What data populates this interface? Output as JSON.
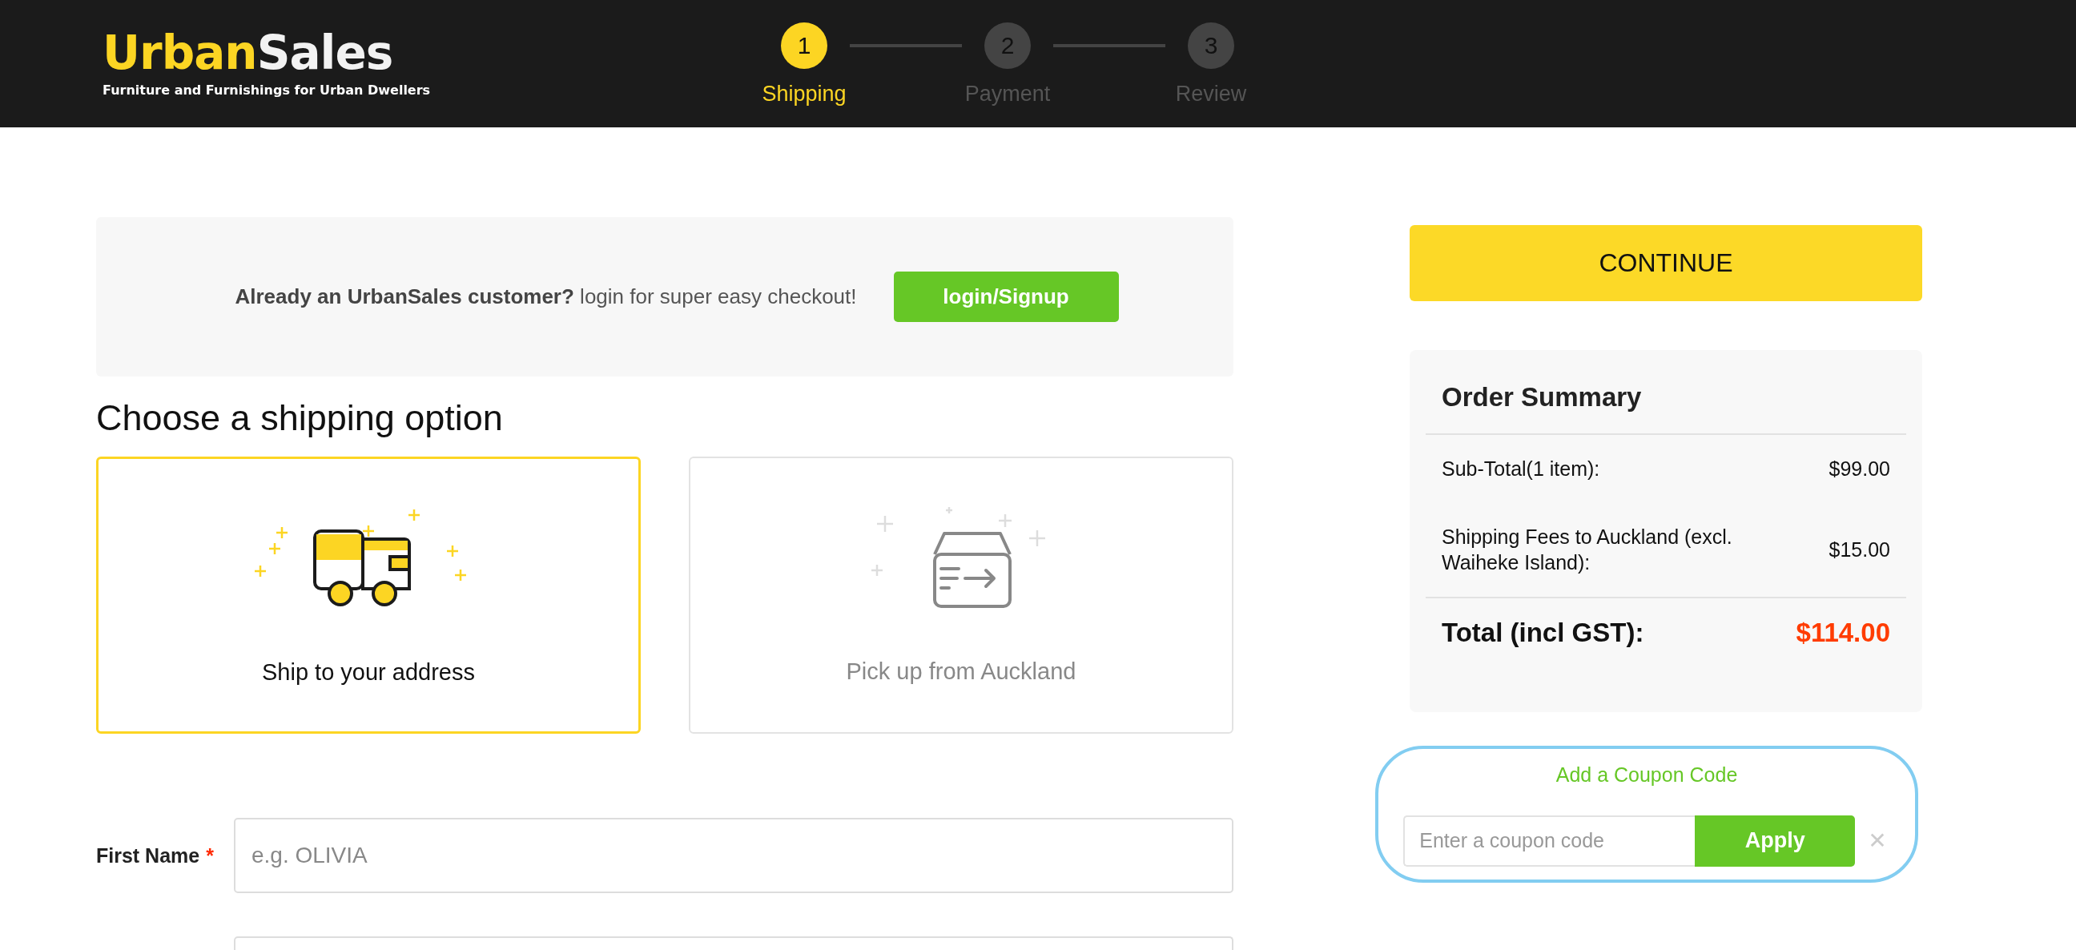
{
  "header": {
    "logo": {
      "part_1": "Urban",
      "part_2": "Sales"
    },
    "tagline": "Furniture and Furnishings for Urban Dwellers"
  },
  "steps": [
    {
      "number": "1",
      "label": "Shipping",
      "selected": true
    },
    {
      "number": "2",
      "label": "Payment",
      "selected": false
    },
    {
      "number": "3",
      "label": "Review",
      "selected": false
    }
  ],
  "login_banner": {
    "text": "**Already an UrbanSales customer?** login for super easy checkout!",
    "button": "login/Signup"
  },
  "shipping": {
    "heading": "Choose a shipping option",
    "options": [
      {
        "kind": "truck",
        "label": "Ship to your address",
        "selected": true
      },
      {
        "kind": "box",
        "label": "Pick up from Auckland",
        "selected": false
      }
    ]
  },
  "fields": [
    {
      "label": "First Name",
      "required": true,
      "required_mark": "*",
      "placeholder": "e.g. OLIVIA"
    }
  ],
  "continue_button": "CONTINUE",
  "order_summary": {
    "title": "Order Summary",
    "lines": [
      {
        "label": "Sub-Total(1 item):",
        "amount": "$99.00"
      },
      {
        "label": "Shipping Fees to Auckland (excl. Waiheke Island):",
        "amount": "$15.00"
      }
    ],
    "total_label": "Total (incl GST):",
    "total_amount": "$114.00"
  },
  "coupon": {
    "title": "Add a Coupon Code",
    "placeholder": "Enter a coupon code",
    "button": "Apply",
    "close": "✕"
  }
}
